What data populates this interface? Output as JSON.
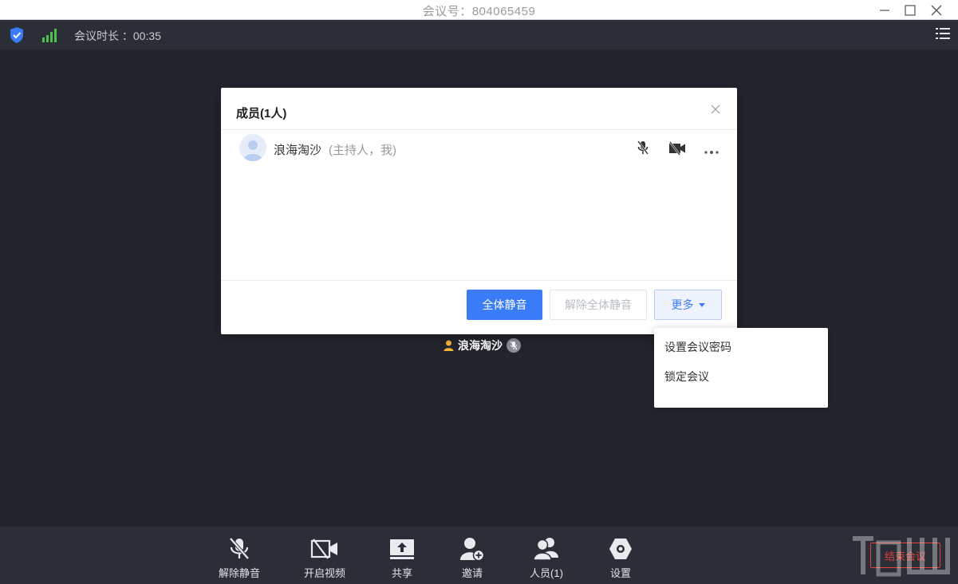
{
  "window": {
    "title": "会议号：804065459"
  },
  "infobar": {
    "duration": "会议时长 ：00:35"
  },
  "members_dialog": {
    "title": "成员(1人)",
    "members": [
      {
        "name": "浪海淘沙",
        "role": "(主持人，我)"
      }
    ],
    "buttons": {
      "mute_all": "全体静音",
      "unmute_all": "解除全体静音",
      "more": "更多"
    }
  },
  "more_menu": {
    "items": [
      "设置会议密码",
      "锁定会议"
    ]
  },
  "speaker": {
    "name": "浪海淘沙"
  },
  "toolbar": {
    "unmute": "解除静音",
    "video": "开启视频",
    "share": "共享",
    "invite": "邀请",
    "members": "人员(1)",
    "settings": "设置",
    "end": "结束会议"
  },
  "colors": {
    "primary": "#3a7cf7",
    "danger": "#e0413b",
    "background": "#22252c",
    "bar": "#2b2e36"
  }
}
